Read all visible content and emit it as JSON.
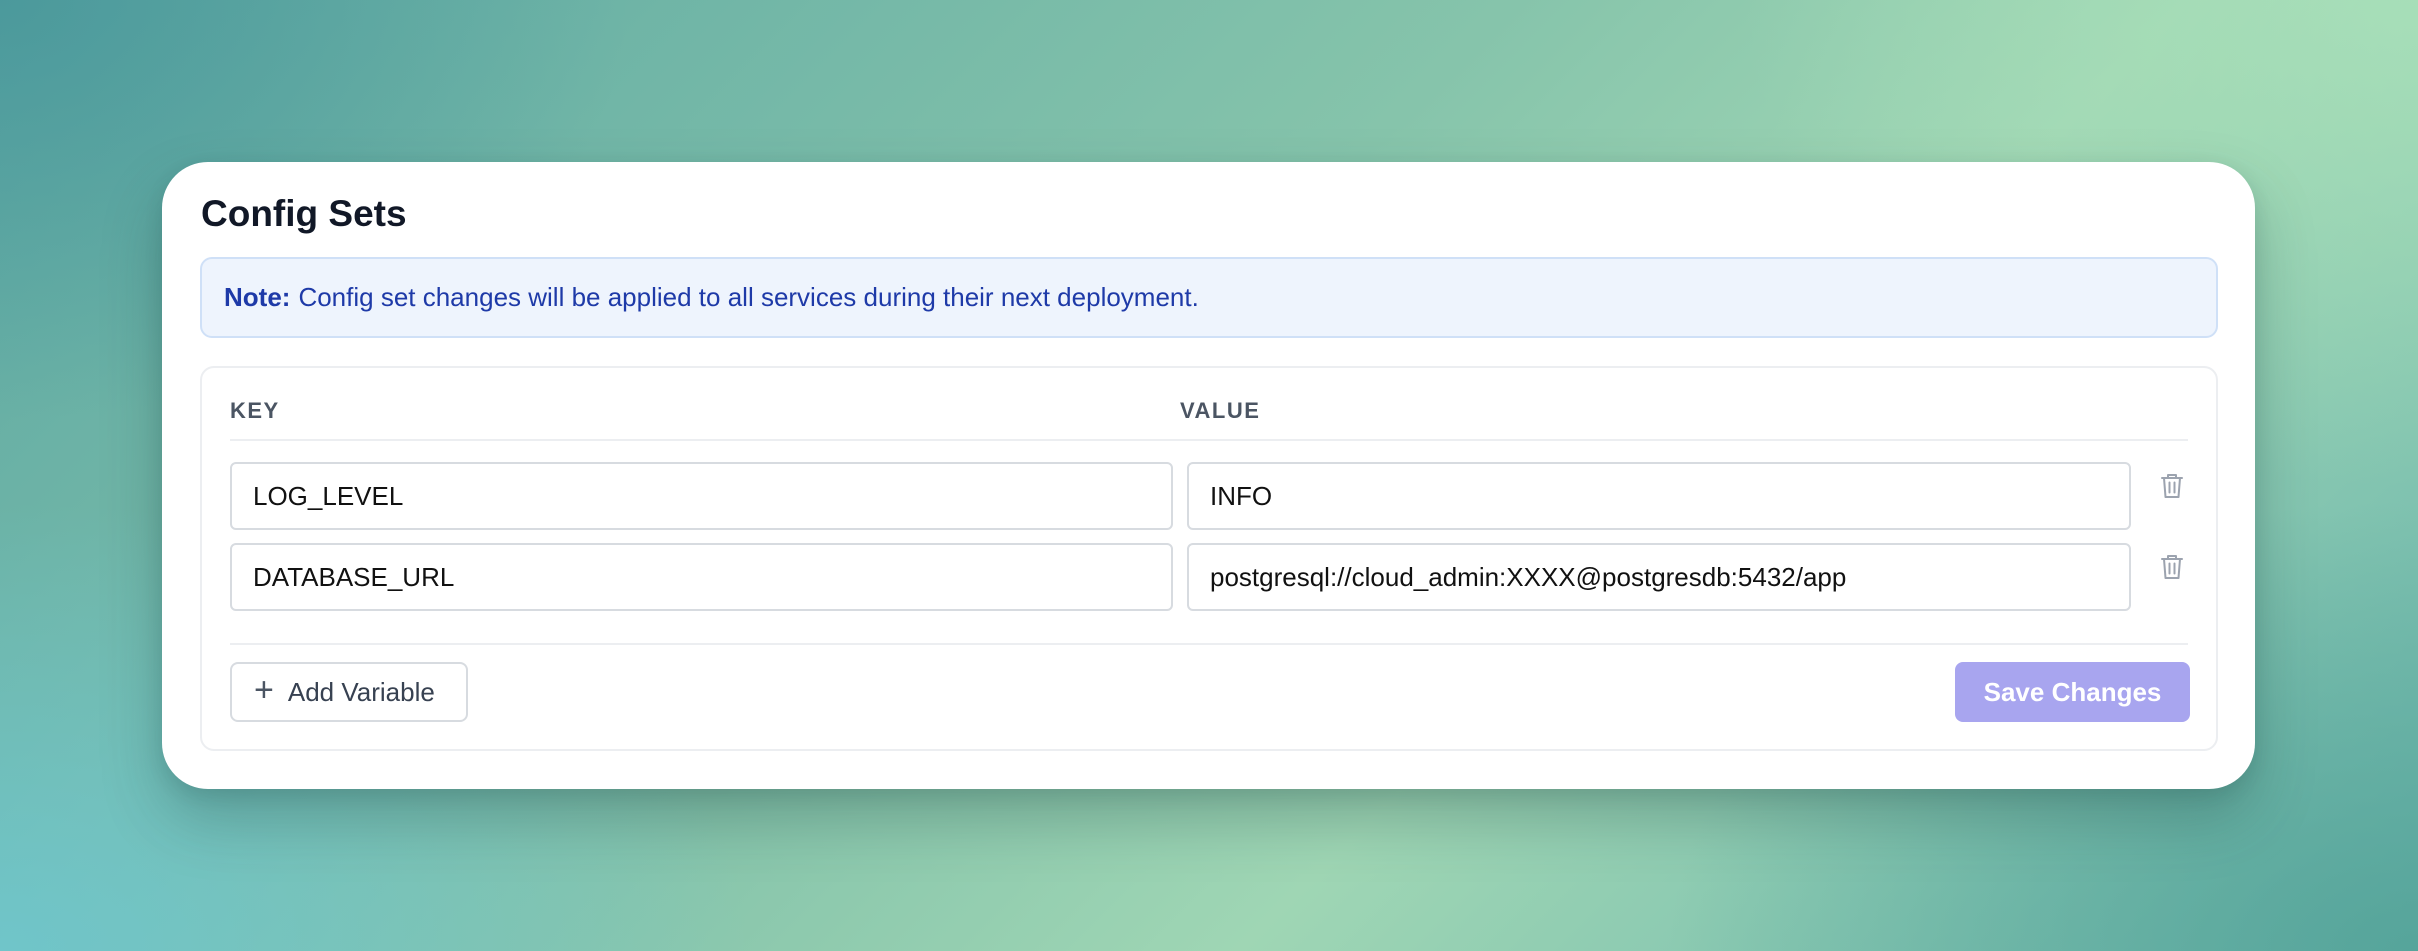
{
  "page": {
    "title": "Config Sets"
  },
  "note": {
    "label": "Note:",
    "text": "Config set changes will be applied to all services during their next deployment."
  },
  "table": {
    "headers": {
      "key": "KEY",
      "value": "VALUE"
    },
    "rows": [
      {
        "key": "LOG_LEVEL",
        "value": "INFO",
        "delete_icon": "trash-icon"
      },
      {
        "key": "DATABASE_URL",
        "value": "postgresql://cloud_admin:XXXX@postgresdb:5432/app",
        "delete_icon": "trash-icon"
      }
    ]
  },
  "actions": {
    "add_icon": "plus-icon",
    "add_label": "Add Variable",
    "save_label": "Save Changes",
    "save_enabled": false
  },
  "colors": {
    "note_background": "#eef4fd",
    "note_text": "#1e3aa8",
    "save_button_disabled": "#a8a5ef",
    "title_text": "#111827"
  }
}
